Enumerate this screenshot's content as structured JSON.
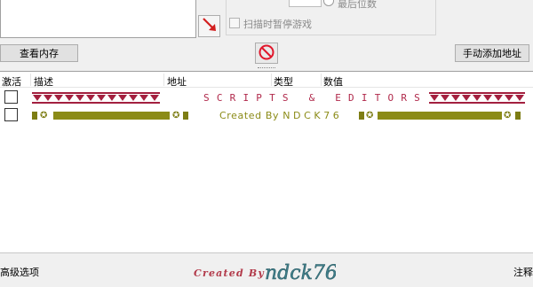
{
  "top": {
    "radio_label": "最后位数",
    "pause_label": "扫描时暂停游戏",
    "view_memory_button": "查看内存",
    "add_address_button": "手动添加地址",
    "arrow_icon": "red-diagonal-arrow-icon",
    "stop_icon": "no-entry-icon"
  },
  "table": {
    "headers": {
      "active": "激活",
      "description": "描述",
      "address": "地址",
      "type": "类型",
      "value": "数值"
    },
    "rows": [
      {
        "description_text": "SCRIPTS & EDITORS",
        "color": "#b0284a"
      },
      {
        "description_created": "Created By",
        "description_author": "NDCK76",
        "color": "#8b8b17"
      }
    ]
  },
  "bottom": {
    "advanced_options": "高级选项",
    "annotation": "注释",
    "signature_prefix": "Created By",
    "signature_name": "ndck76"
  }
}
